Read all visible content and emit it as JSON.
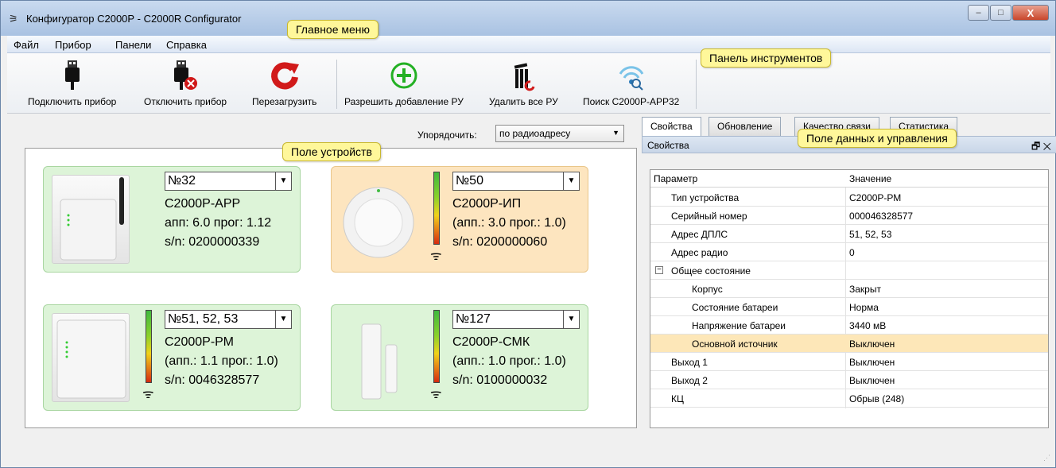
{
  "window": {
    "title": "Конфигуратор С2000Р - С2000R Configurator",
    "min": "–",
    "max": "□",
    "close": "X",
    "app_icon": "plug-icon"
  },
  "menu": {
    "items": [
      "Файл",
      "Прибор",
      "Панели",
      "Справка"
    ]
  },
  "toolbar": {
    "connect": "Подключить прибор",
    "disconnect": "Отключить прибор",
    "restart": "Перезагрузить",
    "allow_add": "Разрешить добавление РУ",
    "delete_all": "Удалить все РУ",
    "search": "Поиск С2000Р-АРР32"
  },
  "callouts": {
    "main_menu": "Главное меню",
    "toolbar": "Панель инструментов",
    "device_field": "Поле устройств",
    "data_field": "Поле данных и управления"
  },
  "sort": {
    "label": "Упорядочить:",
    "value": "по радиоадресу"
  },
  "devices": [
    {
      "number": "№32",
      "name": "С2000Р-АРР",
      "line1": "апп: 6.0 прог: 1.12",
      "line2": "s/n: 0200000339",
      "status": "green"
    },
    {
      "number": "№50",
      "name": "С2000Р-ИП",
      "line1": "(апп.: 3.0 прог.: 1.0)",
      "line2": "s/n: 0200000060",
      "status": "orange"
    },
    {
      "number": "№51, 52, 53",
      "name": "С2000Р-РМ",
      "line1": "(апп.: 1.1 прог.: 1.0)",
      "line2": "s/n: 0046328577",
      "status": "green"
    },
    {
      "number": "№127",
      "name": "С2000Р-СМК",
      "line1": "(апп.: 1.0 прог.: 1.0)",
      "line2": "s/n: 0100000032",
      "status": "green"
    }
  ],
  "tabs": [
    "Свойства",
    "Обновление",
    "Качество связи",
    "Статистика"
  ],
  "props": {
    "header": "Свойства",
    "col_param": "Параметр",
    "col_value": "Значение",
    "rows": [
      {
        "name": "Тип устройства",
        "value": "С2000Р-РМ"
      },
      {
        "name": "Серийный номер",
        "value": "000046328577"
      },
      {
        "name": "Адрес ДПЛС",
        "value": "51, 52, 53"
      },
      {
        "name": "Адрес радио",
        "value": "0"
      },
      {
        "name": "Общее состояние",
        "value": ""
      },
      {
        "name": "Корпус",
        "value": "Закрыт"
      },
      {
        "name": "Состояние батареи",
        "value": "Норма"
      },
      {
        "name": "Напряжение батареи",
        "value": "3440 мВ"
      },
      {
        "name": "Основной источник",
        "value": "Выключен"
      },
      {
        "name": "Выход 1",
        "value": "Выключен"
      },
      {
        "name": "Выход 2",
        "value": "Выключен"
      },
      {
        "name": "КЦ",
        "value": "Обрыв (248)"
      }
    ]
  }
}
